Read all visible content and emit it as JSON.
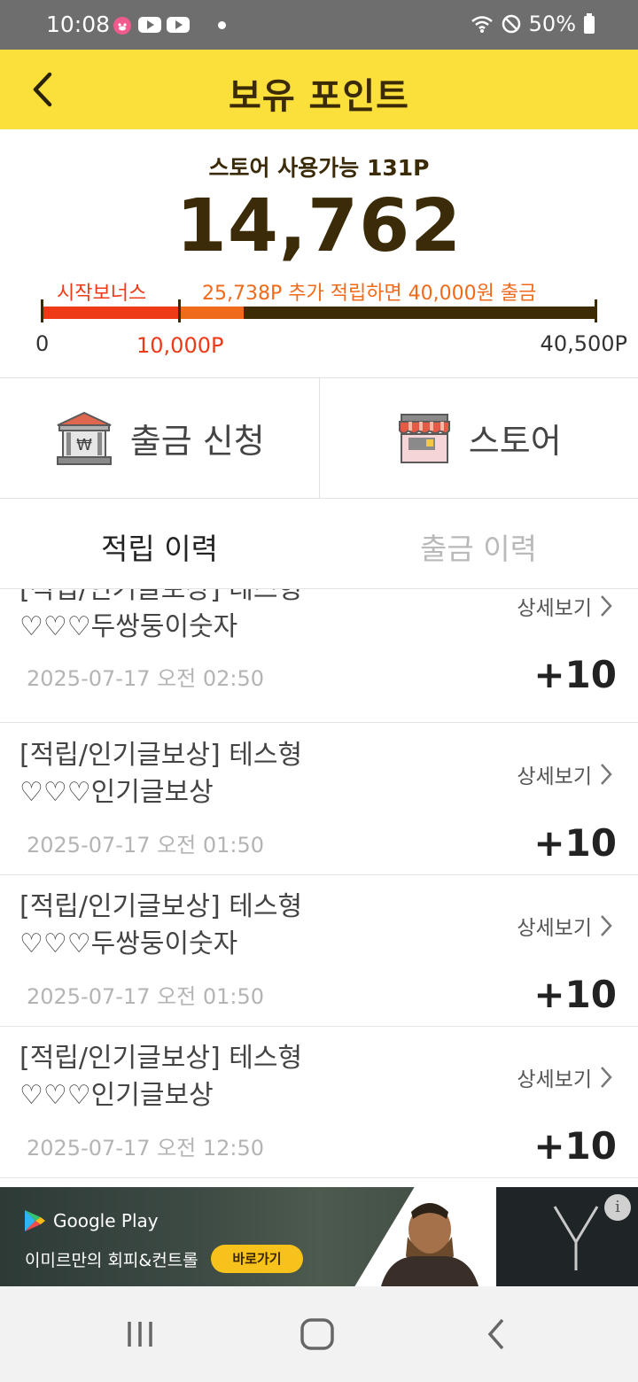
{
  "status_bar": {
    "time": "10:08",
    "battery": "50%"
  },
  "header": {
    "title": "보유 포인트"
  },
  "points": {
    "store_available": "스토어 사용가능 131P",
    "total": "14,762",
    "bonus_label": "시작보너스",
    "goal_text": "25,738P 추가 적립하면 40,000원 출금",
    "scale_min": "0",
    "scale_bonus": "10,000P",
    "scale_max": "40,500P",
    "progress_fraction": 0.3645,
    "bonus_fraction": 0.2469
  },
  "actions": {
    "withdraw_label": "출금 신청",
    "store_label": "스토어"
  },
  "tabs": [
    {
      "label": "적립 이력"
    },
    {
      "label": "출금 이력"
    }
  ],
  "history": [
    {
      "title_line1": "[적립/인기글보상] 테스형",
      "title_line2": "♡♡♡두쌍둥이숫자",
      "date": "2025-07-17 오전 02:50",
      "detail": "상세보기",
      "amount": "+10"
    },
    {
      "title_line1": "[적립/인기글보상] 테스형",
      "title_line2": "♡♡♡인기글보상",
      "date": "2025-07-17 오전 01:50",
      "detail": "상세보기",
      "amount": "+10"
    },
    {
      "title_line1": "[적립/인기글보상] 테스형",
      "title_line2": "♡♡♡두쌍둥이숫자",
      "date": "2025-07-17 오전 01:50",
      "detail": "상세보기",
      "amount": "+10"
    },
    {
      "title_line1": "[적립/인기글보상] 테스형",
      "title_line2": "♡♡♡인기글보상",
      "date": "2025-07-17 오전 12:50",
      "detail": "상세보기",
      "amount": "+10"
    }
  ],
  "ad": {
    "store_name": "Google Play",
    "text": "이미르만의 회피&컨트롤",
    "cta": "바로가기",
    "info": "i"
  }
}
